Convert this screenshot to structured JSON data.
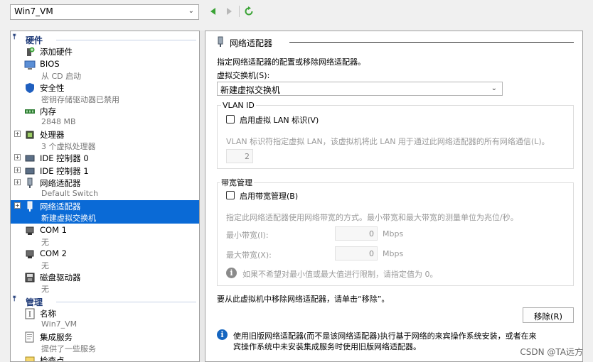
{
  "toolbar": {
    "vm_name": "Win7_VM"
  },
  "sidebar": {
    "hardware_label": "硬件",
    "management_label": "管理",
    "items": [
      {
        "label": "添加硬件",
        "sub": ""
      },
      {
        "label": "BIOS",
        "sub": "从 CD 启动"
      },
      {
        "label": "安全性",
        "sub": "密钥存储驱动器已禁用"
      },
      {
        "label": "内存",
        "sub": "2848 MB"
      },
      {
        "label": "处理器",
        "sub": "3 个虚拟处理器"
      },
      {
        "label": "IDE 控制器 0",
        "sub": ""
      },
      {
        "label": "IDE 控制器 1",
        "sub": ""
      },
      {
        "label": "网络适配器",
        "sub": "Default Switch"
      },
      {
        "label": "网络适配器",
        "sub": "新建虚拟交换机"
      },
      {
        "label": "COM 1",
        "sub": "无"
      },
      {
        "label": "COM 2",
        "sub": "无"
      },
      {
        "label": "磁盘驱动器",
        "sub": "无"
      },
      {
        "label": "名称",
        "sub": "Win7_VM"
      },
      {
        "label": "集成服务",
        "sub": "提供了一些服务"
      },
      {
        "label": "检查点",
        "sub": ""
      }
    ]
  },
  "panel": {
    "title": "网络适配器",
    "description": "指定网络适配器的配置或移除网络适配器。",
    "switch_label": "虚拟交换机(S):",
    "switch_value": "新建虚拟交换机",
    "vlan": {
      "legend": "VLAN ID",
      "checkbox_label": "启用虚拟 LAN 标识(V)",
      "help": "VLAN 标识符指定虚拟 LAN，该虚拟机将此 LAN 用于通过此网络适配器的所有网络通信(L)。",
      "value": "2"
    },
    "bandwidth": {
      "legend": "带宽管理",
      "checkbox_label": "启用带宽管理(B)",
      "help": "指定此网络适配器使用网络带宽的方式。最小带宽和最大带宽的测量单位为兆位/秒。",
      "min_label": "最小带宽(I):",
      "min_value": "0",
      "max_label": "最大带宽(X):",
      "max_value": "0",
      "unit": "Mbps",
      "note": "如果不希望对最小值或最大值进行限制，请指定值为 0。"
    },
    "remove_text": "要从此虚拟机中移除网络适配器，请单击“移除”。",
    "remove_button": "移除(R)",
    "legacy_info_line1": "使用旧版网络适配器(而不是该网络适配器)执行基于网络的来宾操作系统安装，或者在来",
    "legacy_info_line2": "宾操作系统中未安装集成服务时使用旧版网络适配器。"
  },
  "watermark": "CSDN @TA远方",
  "colors": {
    "selection": "#0a6ad6",
    "section_header": "#1e3a78",
    "nav_arrow": "#3aa335",
    "info_icon": "#1565c0"
  }
}
